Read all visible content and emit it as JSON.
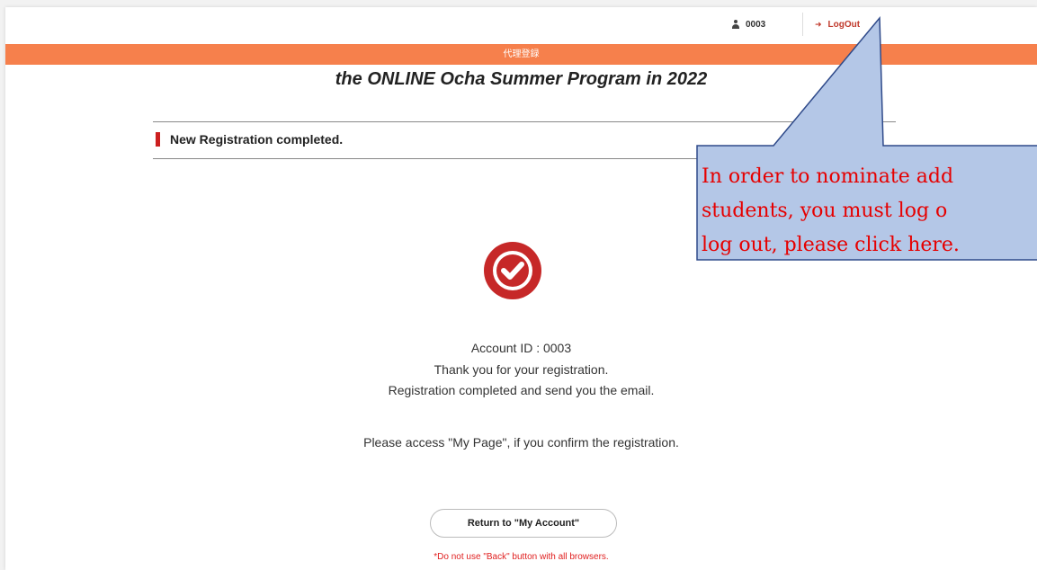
{
  "header": {
    "account_id": "0003",
    "logout_label": "LogOut",
    "banner_label": "代理登録",
    "program_title": "the ONLINE Ocha Summer Program in 2022"
  },
  "section": {
    "title": "New Registration completed."
  },
  "main": {
    "account_line": "Account ID : 0003",
    "thanks_line": "Thank you for your registration.",
    "email_line": "Registration completed and send you the email.",
    "mypage_line": "Please access \"My Page\", if you confirm the registration.",
    "return_button": "Return to \"My Account\"",
    "warning": "*Do not use \"Back\" button with all browsers."
  },
  "callout": {
    "line1": "In order to nominate add",
    "line2": "students, you must log o",
    "line3": "log out, please click here."
  },
  "colors": {
    "accent_orange": "#f6804c",
    "check_red": "#c62828",
    "callout_fill": "#b4c7e7",
    "callout_border": "#2f4a8a",
    "callout_text": "#e60000"
  }
}
